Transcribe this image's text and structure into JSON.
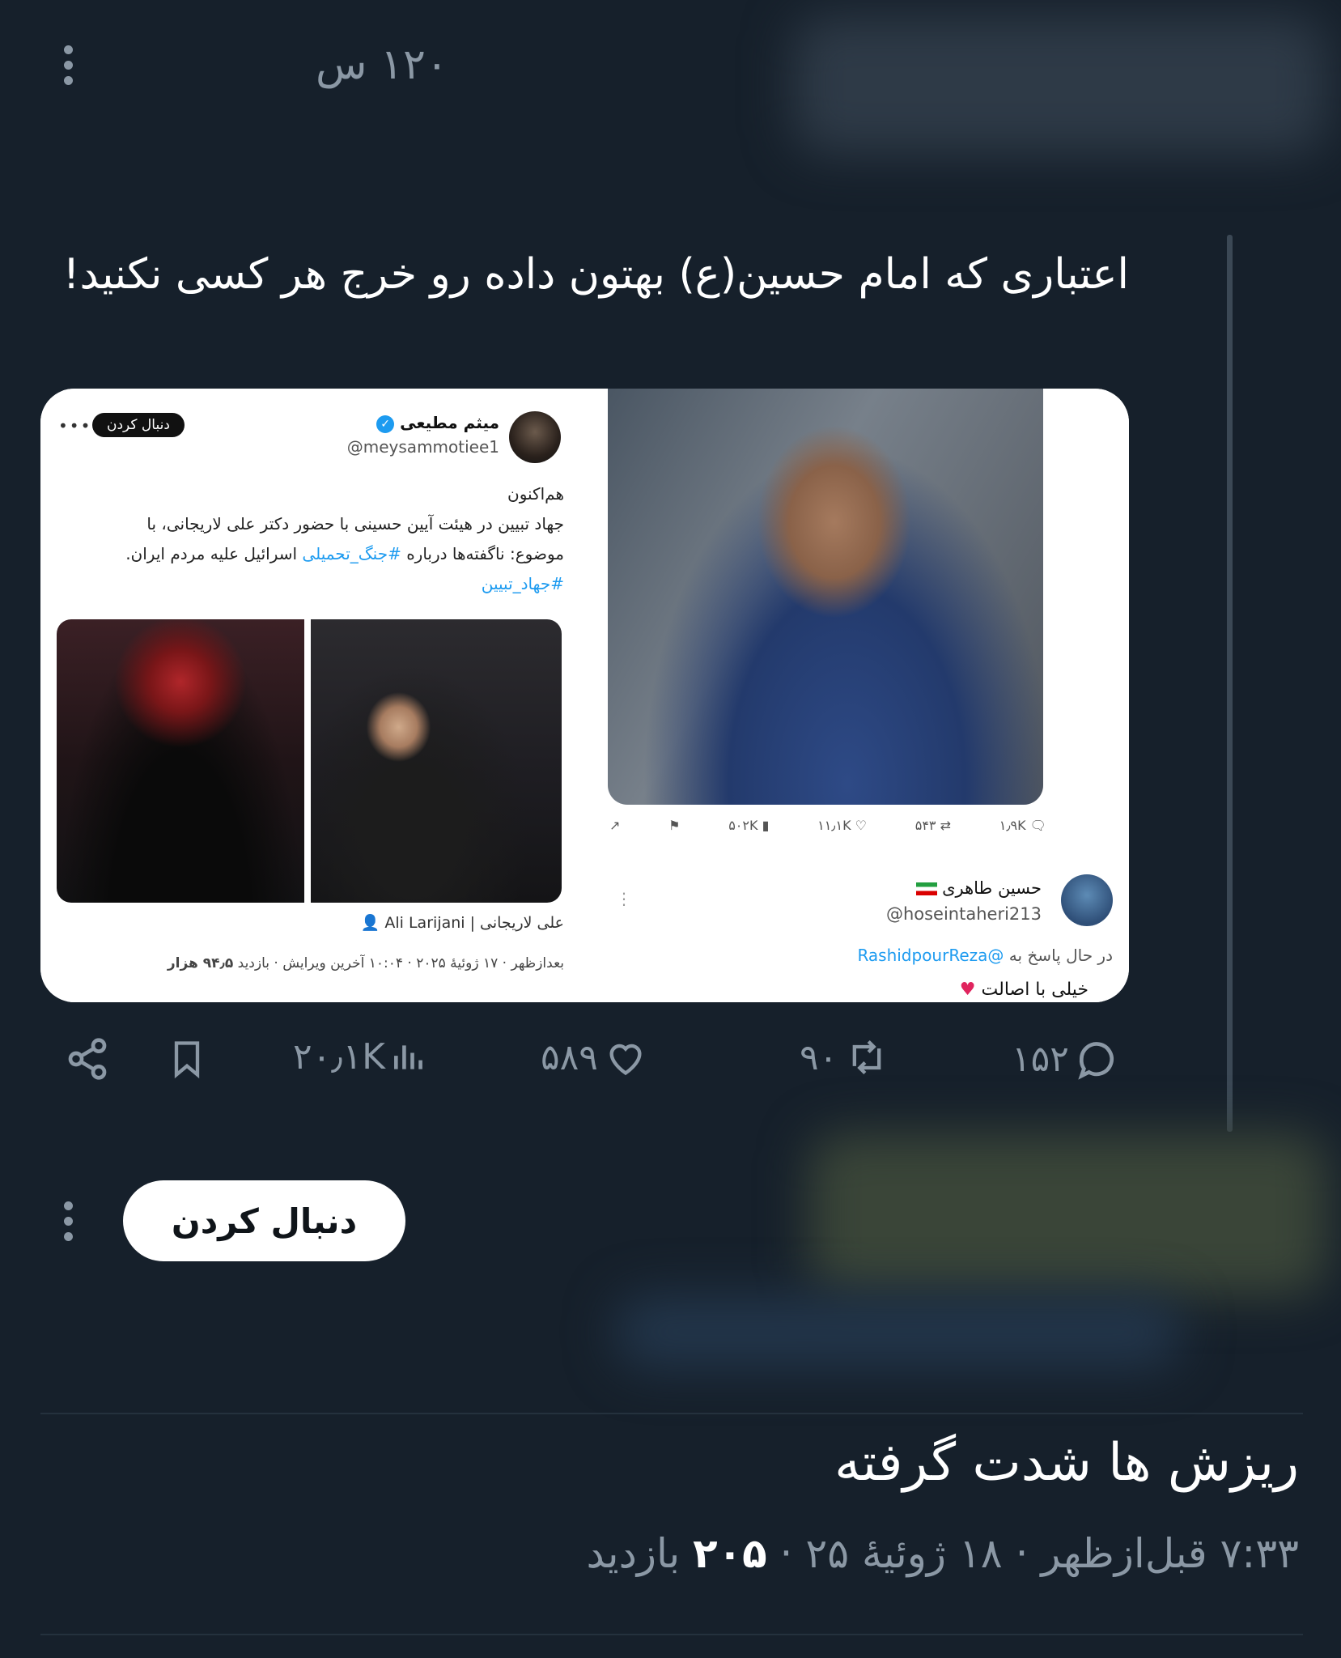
{
  "top_post": {
    "timestamp": "۱۲۰ س"
  },
  "quoted_post": {
    "text": "اعتباری که امام حسین(ع) بهتون داده رو خرج هر کسی نکنید!",
    "actions": {
      "replies": "۱۵۲",
      "retweets": "۹۰",
      "likes": "۵۸۹",
      "views": "۲۰٫۱K"
    }
  },
  "media_left": {
    "name": "میثم مطیعی",
    "handle": "@meysammotiee1",
    "follow_label": "دنبال کردن",
    "line1": "هم‌اکنون",
    "line2": "جهاد تبیین در هیئت آیین حسینی با حضور دکتر علی لاریجانی، با",
    "line3_prefix": "موضوع: ناگفته‌ها درباره",
    "line3_hashtag": "#جنگ_تحمیلی",
    "line3_suffix": "اسرائیل علیه مردم ایران.",
    "line4_hashtag": "#جهاد_تبیین",
    "photo_author": "علی لاریجانی | Ali Larijani",
    "meta_prefix": "بعدازظهر · ۱۷ ژوئیهٔ ۲۰۲۵ · ۱۰:۰۴ آخرین ویرایش · بازدید",
    "meta_views": "۹۴٫۵ هزار"
  },
  "media_right": {
    "actions": {
      "replies": "۱٫۹K",
      "retweets": "۵۴۳",
      "likes": "۱۱٫۱K",
      "views": "۵۰۲K"
    },
    "name": "حسین طاهری",
    "handle": "@hoseintaheri213",
    "reply_prefix": "در حال پاسخ به",
    "reply_mention": "@RashidpourReza",
    "cut_text": "خیلی با اصالت"
  },
  "follow_button": {
    "label": "دنبال کردن"
  },
  "main_post": {
    "text": "ریزش ها شدت گرفته",
    "time": "۷:۳۳ قبل‌ازظهر · ۱۸ ژوئیهٔ ۲۵ ·",
    "views_count": "۲۰۵",
    "views_label": "بازدید"
  },
  "colors": {
    "background": "#16202b",
    "accent": "#1d9bf0",
    "muted": "#8b98a5"
  }
}
